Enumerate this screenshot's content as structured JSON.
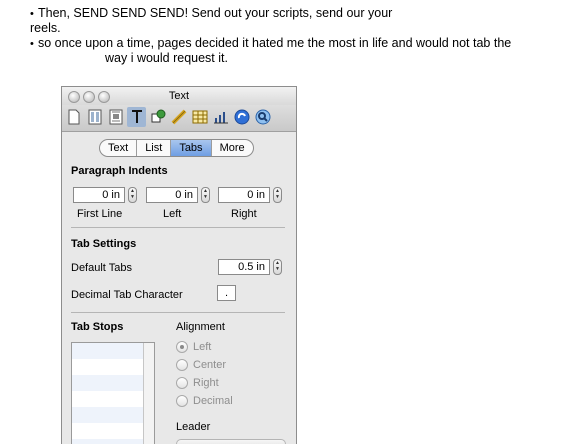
{
  "notes": [
    {
      "bullet": "•",
      "text": "Then, SEND SEND SEND! Send out your scripts, send our your"
    },
    {
      "bullet": "",
      "text": "reels."
    },
    {
      "bullet": "•",
      "text": "so once upon a time, pages decided it hated me the most in life and would not tab the"
    },
    {
      "bullet": "",
      "text": "way i would request it."
    }
  ],
  "window": {
    "title": "Text"
  },
  "toolbar": {
    "icons": [
      "document-icon",
      "layout-icon",
      "wrap-icon",
      "text-icon",
      "graphic-icon",
      "metrics-icon",
      "table-icon",
      "chart-icon",
      "link-icon",
      "quicktime-icon"
    ],
    "active": "text-icon"
  },
  "tabs": [
    {
      "label": "Text",
      "selected": false
    },
    {
      "label": "List",
      "selected": false
    },
    {
      "label": "Tabs",
      "selected": true
    },
    {
      "label": "More",
      "selected": false
    }
  ],
  "paragraph_indents": {
    "title": "Paragraph Indents",
    "first_line": {
      "value": "0 in",
      "label": "First Line"
    },
    "left": {
      "value": "0 in",
      "label": "Left"
    },
    "right": {
      "value": "0 in",
      "label": "Right"
    }
  },
  "tab_settings": {
    "title": "Tab Settings",
    "default_tabs_label": "Default Tabs",
    "default_tabs_value": "0.5 in",
    "decimal_char_label": "Decimal Tab Character",
    "decimal_char_value": "."
  },
  "tab_stops": {
    "title": "Tab Stops",
    "alignment_label": "Alignment",
    "alignment_options": [
      "Left",
      "Center",
      "Right",
      "Decimal"
    ],
    "alignment_selected": "Left",
    "leader_label": "Leader"
  }
}
